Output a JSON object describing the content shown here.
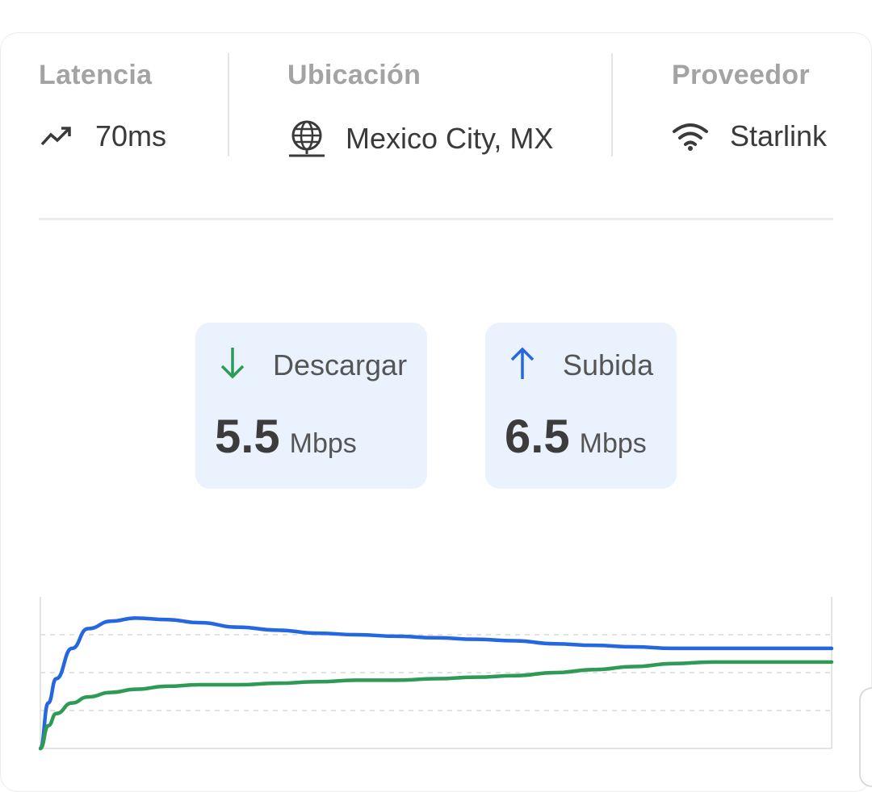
{
  "stats": {
    "latency": {
      "label": "Latencia",
      "value": "70ms",
      "icon": "trending-up-icon"
    },
    "location": {
      "label": "Ubicación",
      "value": "Mexico City, MX",
      "icon": "globe-icon"
    },
    "provider": {
      "label": "Proveedor",
      "value": "Starlink",
      "icon": "wifi-icon"
    }
  },
  "speeds": {
    "download": {
      "title": "Descargar",
      "value": "5.5",
      "unit": "Mbps",
      "icon": "arrow-down-icon",
      "color": "#2e9a55"
    },
    "upload": {
      "title": "Subida",
      "value": "6.5",
      "unit": "Mbps",
      "icon": "arrow-up-icon",
      "color": "#2467e0"
    }
  },
  "colors": {
    "upload_line": "#2467e0",
    "download_line": "#2e9a55",
    "label_gray": "#a3a3a3",
    "box_bg": "#eaf2fd"
  },
  "chart_data": {
    "type": "line",
    "grid": true,
    "ylim": [
      0,
      10
    ],
    "series": [
      {
        "color": "#2467e0",
        "x": [
          0,
          1,
          2,
          4,
          6,
          9,
          12,
          16,
          20,
          25,
          30,
          35,
          40,
          45,
          50,
          55,
          60,
          65,
          70,
          75,
          80,
          85,
          90,
          95,
          100
        ],
        "values": [
          0,
          3.0,
          4.6,
          6.6,
          7.9,
          8.4,
          8.6,
          8.5,
          8.3,
          8.0,
          7.8,
          7.6,
          7.5,
          7.4,
          7.3,
          7.2,
          7.1,
          6.9,
          6.8,
          6.7,
          6.6,
          6.6,
          6.6,
          6.6,
          6.6
        ]
      },
      {
        "color": "#2e9a55",
        "x": [
          0,
          1,
          2,
          4,
          6,
          9,
          12,
          16,
          20,
          25,
          30,
          35,
          40,
          45,
          50,
          55,
          60,
          65,
          70,
          75,
          80,
          85,
          90,
          95,
          100
        ],
        "values": [
          0,
          1.5,
          2.3,
          3.0,
          3.4,
          3.7,
          3.9,
          4.1,
          4.2,
          4.2,
          4.3,
          4.4,
          4.5,
          4.5,
          4.6,
          4.7,
          4.8,
          5.0,
          5.2,
          5.4,
          5.6,
          5.7,
          5.7,
          5.7,
          5.7
        ]
      }
    ]
  }
}
